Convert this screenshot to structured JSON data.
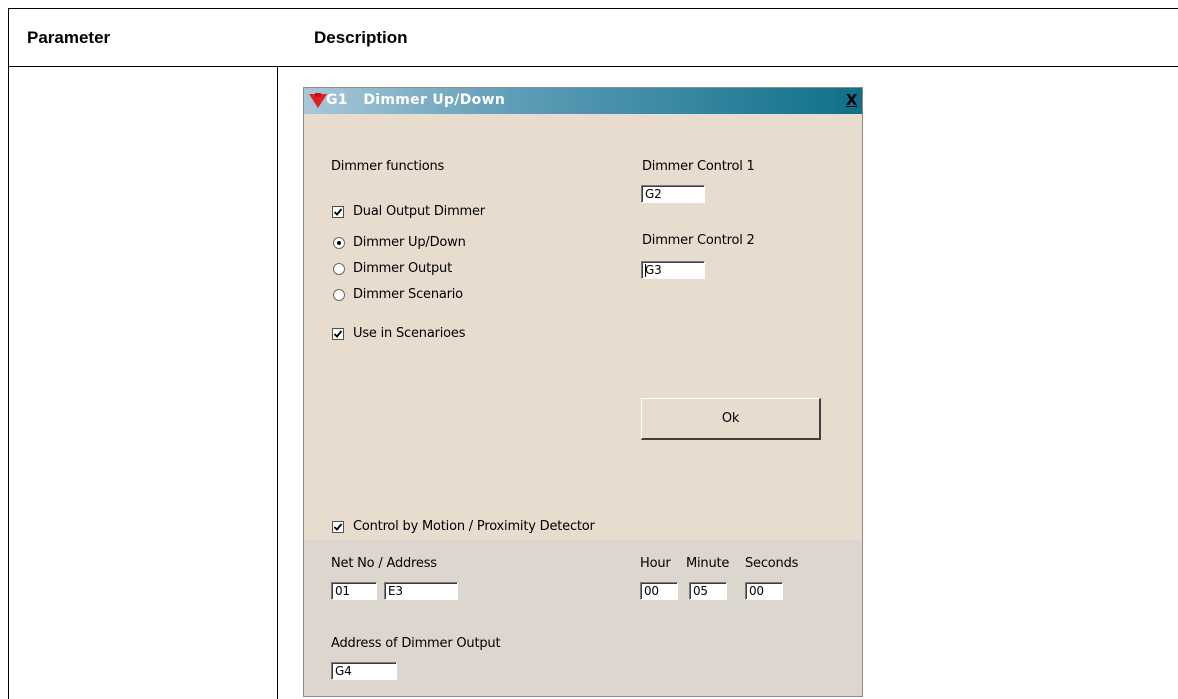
{
  "table": {
    "headers": [
      "Parameter",
      "Description"
    ]
  },
  "dialog": {
    "title_id": "G1",
    "title": "Dimmer Up/Down",
    "close_glyph": "×",
    "close_label": "X",
    "sections": {
      "functions_label": "Dimmer functions",
      "control1_label": "Dimmer Control 1",
      "control1_value": "G2",
      "control2_label": "Dimmer Control 2",
      "control2_value": "G3"
    },
    "checkboxes": {
      "dual_output": {
        "label": "Dual Output Dimmer",
        "checked": true
      },
      "use_in_scenarios": {
        "label": "Use in Scenarioes",
        "checked": true
      },
      "motion_control": {
        "label": "Control by Motion / Proximity Detector",
        "checked": true
      }
    },
    "radios": [
      {
        "label": "Dimmer Up/Down",
        "selected": true
      },
      {
        "label": "Dimmer Output",
        "selected": false
      },
      {
        "label": "Dimmer Scenario",
        "selected": false
      }
    ],
    "ok_label": "Ok",
    "bottom": {
      "net_label": "Net No / Address",
      "net_no": "01",
      "address": "E3",
      "hour_label": "Hour",
      "minute_label": "Minute",
      "seconds_label": "Seconds",
      "hour": "00",
      "minute": "05",
      "seconds": "00",
      "dimmer_output_label": "Address of Dimmer Output",
      "dimmer_output_value": "G4"
    }
  },
  "icons": [
    "dimmer-icon",
    "close-icon",
    "checkmark-icon"
  ],
  "colors": {
    "title_bar_start": "#a9c7d8",
    "title_bar_end": "#0f7088",
    "dialog_bg": "#e8dccf",
    "icon_red": "#e31e24"
  }
}
